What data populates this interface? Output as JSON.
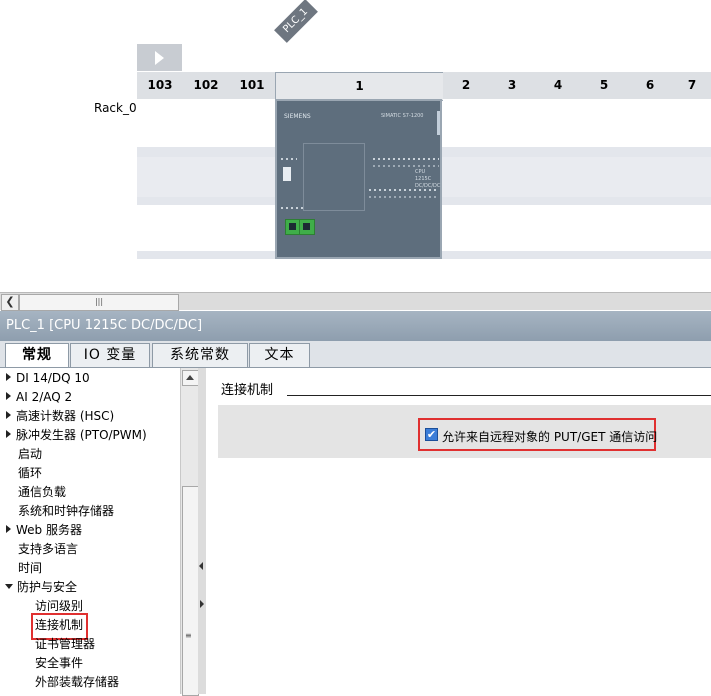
{
  "device_view": {
    "device_tag": "PLC_1",
    "rack_name": "Rack_0",
    "slots": [
      "103",
      "102",
      "101",
      "1",
      "2",
      "3",
      "4",
      "5",
      "6",
      "7"
    ],
    "cpu_module": {
      "brand": "SIEMENS",
      "series": "SIMATIC S7-1200",
      "model_lines": [
        "CPU 1215C",
        "DC/DC/DC"
      ]
    }
  },
  "properties": {
    "header": "PLC_1 [CPU 1215C DC/DC/DC]",
    "tabs": [
      "常规",
      "IO 变量",
      "系统常数",
      "文本"
    ],
    "active_tab": "常规",
    "nav_tree": [
      {
        "label": "DI 14/DQ 10",
        "expander": "collapsed"
      },
      {
        "label": "AI 2/AQ 2",
        "expander": "collapsed"
      },
      {
        "label": "高速计数器 (HSC)",
        "expander": "collapsed"
      },
      {
        "label": "脉冲发生器 (PTO/PWM)",
        "expander": "collapsed"
      },
      {
        "label": "启动",
        "expander": "none"
      },
      {
        "label": "循环",
        "expander": "none"
      },
      {
        "label": "通信负载",
        "expander": "none"
      },
      {
        "label": "系统和时钟存储器",
        "expander": "none"
      },
      {
        "label": "Web 服务器",
        "expander": "collapsed"
      },
      {
        "label": "支持多语言",
        "expander": "none"
      },
      {
        "label": "时间",
        "expander": "none"
      },
      {
        "label": "防护与安全",
        "expander": "expanded"
      },
      {
        "label": "访问级别",
        "expander": "child"
      },
      {
        "label": "连接机制",
        "expander": "child",
        "selected": true
      },
      {
        "label": "证书管理器",
        "expander": "child"
      },
      {
        "label": "安全事件",
        "expander": "child"
      },
      {
        "label": "外部装载存储器",
        "expander": "child"
      }
    ],
    "section": {
      "title": "连接机制",
      "checkbox_label": "允许来自远程对象的 PUT/GET 通信访问",
      "checkbox_checked": true
    }
  },
  "colors": {
    "highlight": "#e03030",
    "checkbox": "#3b7dd8",
    "header_bar": "#9aa8b6"
  }
}
